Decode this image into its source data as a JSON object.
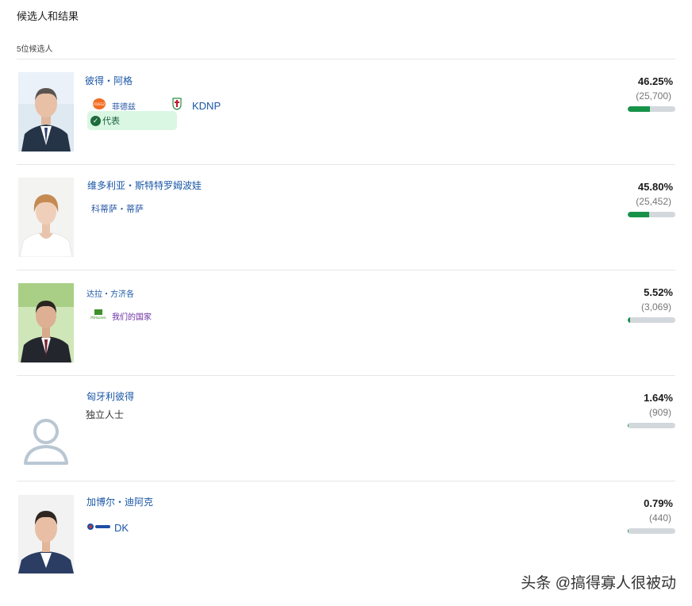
{
  "header": {
    "title": "候选人和结果",
    "count_label": "5位候选人"
  },
  "candidates": [
    {
      "name": "彼得・阿格",
      "parties": [
        {
          "label": "菲德兹",
          "logo": "fidesz-logo"
        },
        {
          "label": "KDNP",
          "logo": "kdnp-logo"
        }
      ],
      "badge": "代表",
      "percent": "46.25%",
      "votes": "(25,700)",
      "share": 0.4625
    },
    {
      "name": "维多利亚・斯特特罗姆波娃",
      "parties": [
        {
          "label": "科蒂萨・蒂萨",
          "logo": ""
        }
      ],
      "percent": "45.80%",
      "votes": "(25,452)",
      "share": 0.458
    },
    {
      "name": "达拉・方济各",
      "parties": [
        {
          "label": "我们的国家",
          "logo": "mi-hazank-logo"
        }
      ],
      "percent": "5.52%",
      "votes": "(3,069)",
      "share": 0.0552
    },
    {
      "name": "匈牙利彼得",
      "parties": [
        {
          "label": "独立人士",
          "logo": ""
        }
      ],
      "percent": "1.64%",
      "votes": "(909)",
      "share": 0.0164
    },
    {
      "name": "加博尔・迪阿克",
      "parties": [
        {
          "label": "DK",
          "logo": "dk-logo"
        }
      ],
      "percent": "0.79%",
      "votes": "(440)",
      "share": 0.0079
    }
  ],
  "watermark": "头条 @搞得寡人很被动",
  "colors": {
    "bar_fill": "#179349",
    "bar_track": "#d3d8dd",
    "elected_bg": "#d9f7e3",
    "name_link": "#1a57a6"
  }
}
